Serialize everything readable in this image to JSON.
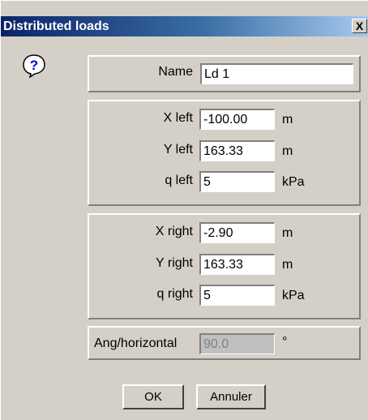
{
  "window": {
    "title": "Distributed loads",
    "close_glyph": "X"
  },
  "help_icon": {
    "icon": "question-icon",
    "glyph": "?"
  },
  "name_row": {
    "label": "Name",
    "value": "Ld 1"
  },
  "left_group": {
    "x_label": "X left",
    "x_value": "-100.00",
    "x_unit": "m",
    "y_label": "Y left",
    "y_value": "163.33",
    "y_unit": "m",
    "q_label": "q left",
    "q_value": "5",
    "q_unit": "kPa"
  },
  "right_group": {
    "x_label": "X right",
    "x_value": "-2.90",
    "x_unit": "m",
    "y_label": "Y right",
    "y_value": "163.33",
    "y_unit": "m",
    "q_label": "q right",
    "q_value": "5",
    "q_unit": "kPa"
  },
  "angle_row": {
    "label": "Ang/horizontal",
    "value": "90.0",
    "unit": "°"
  },
  "buttons": {
    "ok": "OK",
    "cancel": "Annuler"
  },
  "colors": {
    "title_bar": "#0a246a",
    "dialog_bg": "#d4d0c8"
  }
}
